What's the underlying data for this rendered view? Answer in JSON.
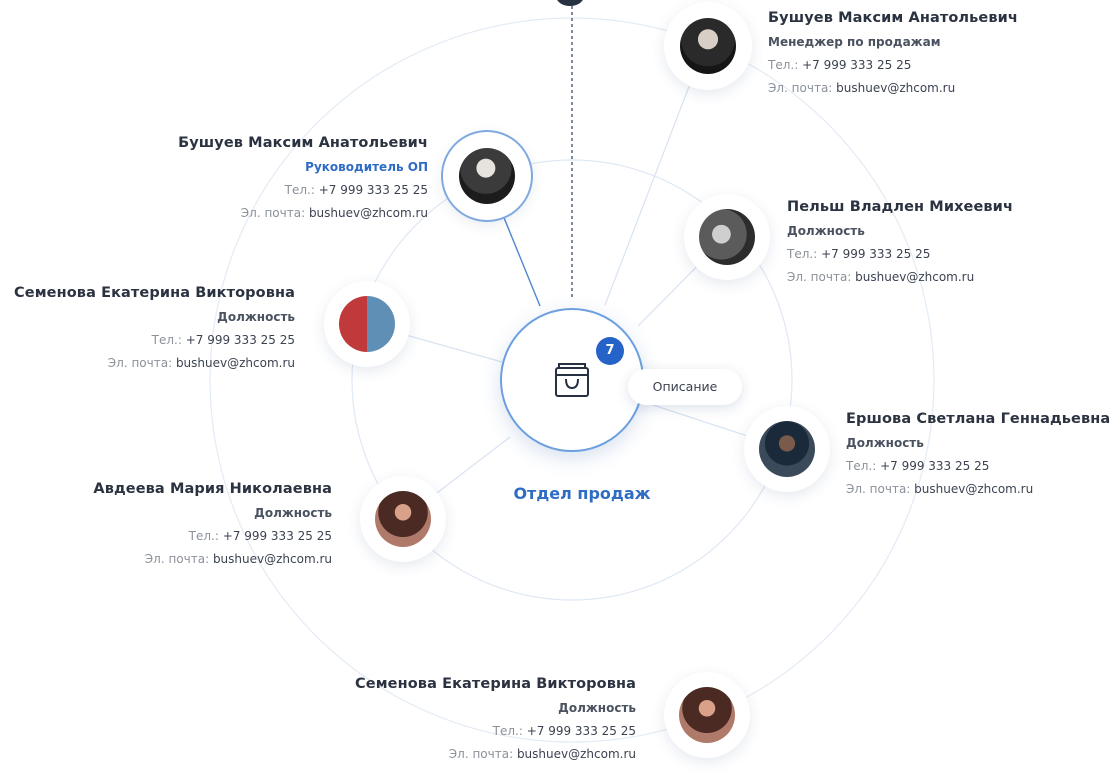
{
  "department": {
    "title": "Отдел продаж",
    "badge_count": "7",
    "description_button": "Описание",
    "icon": "shopping-bag-icon"
  },
  "labels": {
    "phone_prefix": "Тел.: ",
    "email_prefix": "Эл. почта: "
  },
  "employees": [
    {
      "name": "Бушуев Максим Анатольевич",
      "role": "Менеджер по продажам",
      "phone": "+7 999 333 25 25",
      "email": "bushuev@zhcom.ru"
    },
    {
      "name": "Бушуев Максим Анатольевич",
      "role": "Руководитель ОП",
      "phone": "+7 999 333 25 25",
      "email": "bushuev@zhcom.ru"
    },
    {
      "name": "Пельш Владлен Михеевич",
      "role": "Должность",
      "phone": "+7 999 333 25 25",
      "email": "bushuev@zhcom.ru"
    },
    {
      "name": "Семенова Екатерина Викторовна",
      "role": "Должность",
      "phone": "+7 999 333 25 25",
      "email": "bushuev@zhcom.ru"
    },
    {
      "name": "Ершова Светлана Геннадьевна",
      "role": "Должность",
      "phone": "+7 999 333 25 25",
      "email": "bushuev@zhcom.ru"
    },
    {
      "name": "Авдеева Мария Николаевна",
      "role": "Должность",
      "phone": "+7 999 333 25 25",
      "email": "bushuev@zhcom.ru"
    },
    {
      "name": "Семенова Екатерина Викторовна",
      "role": "Должность",
      "phone": "+7 999 333 25 25",
      "email": "bushuev@zhcom.ru"
    }
  ],
  "colors": {
    "accent": "#2f6cc4",
    "badge": "#2563c9",
    "ring": "#dbe6f3",
    "lead_link": "#4f86cf"
  }
}
